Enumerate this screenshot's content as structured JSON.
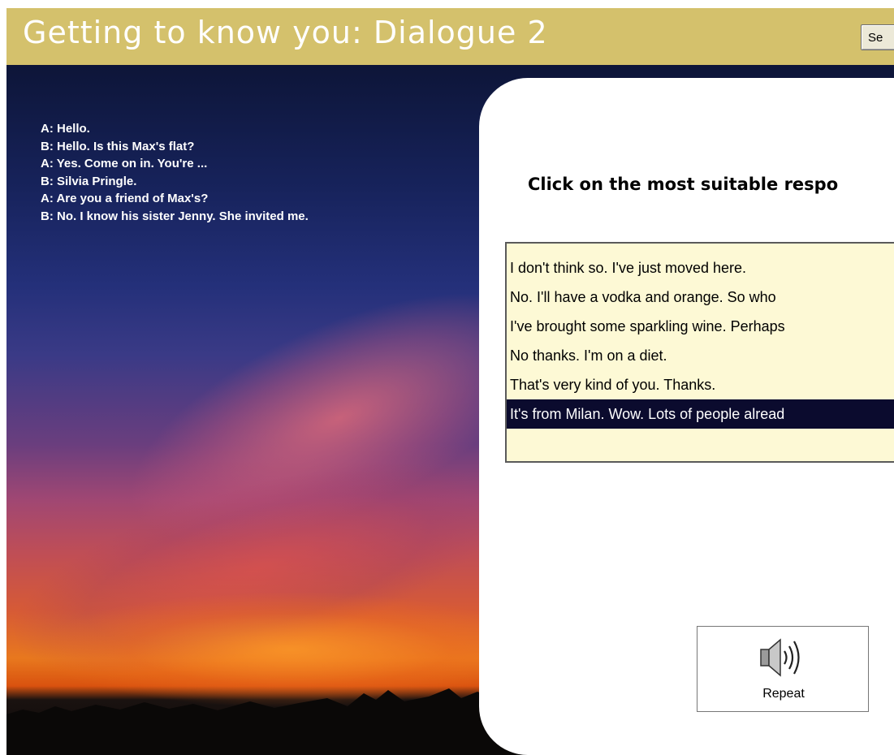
{
  "header": {
    "title": "Getting to know you:  Dialogue 2",
    "setup_label": "Se"
  },
  "dialogue": [
    "A: Hello.",
    "B: Hello. Is this Max's flat?",
    "A: Yes. Come on in. You're ...",
    "B: Silvia Pringle.",
    "A: Are you a friend of Max's?",
    "B: No. I know his sister Jenny. She invited me."
  ],
  "panel": {
    "instruction": "Click on the most suitable respo",
    "options": [
      "I don't think so. I've just moved here.",
      "No. I'll have a vodka and orange. So who",
      "I've brought some sparkling wine. Perhaps",
      "No thanks. I'm on a diet.",
      "That's very kind of you. Thanks.",
      "It's from Milan. Wow. Lots of people alread"
    ],
    "selected_index": 5,
    "repeat_label": "Repeat",
    "repeat_icon": "speaker-icon"
  },
  "colors": {
    "title_bar": "#d4c16c",
    "options_bg": "#fdf9d5",
    "selected_bg": "#0b0b2e"
  }
}
